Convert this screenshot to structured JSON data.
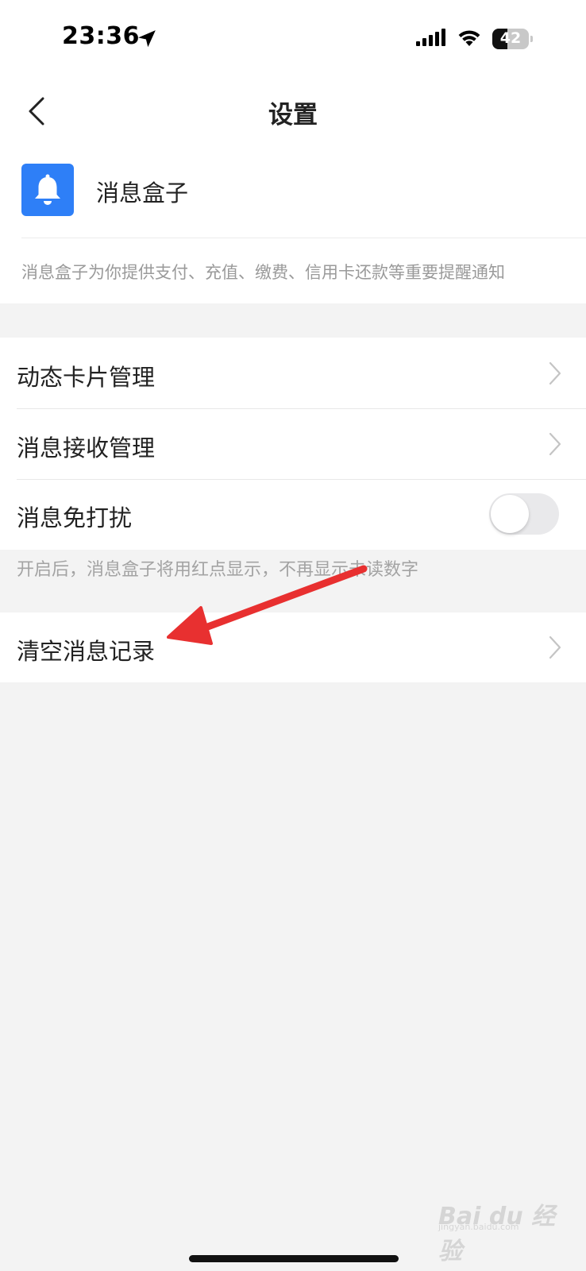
{
  "status_bar": {
    "time": "23:36",
    "battery": "42",
    "battery_level": 0.42,
    "icons": [
      "location-arrow-icon",
      "cellular-signal-icon",
      "wifi-icon",
      "battery-icon"
    ]
  },
  "nav": {
    "title": "设置",
    "back_icon": "chevron-left-icon"
  },
  "app": {
    "name": "消息盒子",
    "icon": "bell-icon",
    "icon_color": "#2e7ff7",
    "description": "消息盒子为你提供支付、充值、缴费、信用卡还款等重要提醒通知"
  },
  "settings": {
    "items": [
      {
        "label": "动态卡片管理",
        "control": "chevron"
      },
      {
        "label": "消息接收管理",
        "control": "chevron"
      },
      {
        "label": "消息免打扰",
        "control": "toggle",
        "on": false
      }
    ],
    "dnd_hint": "开启后，消息盒子将用红点显示，不再显示未读数字",
    "clear": {
      "label": "清空消息记录",
      "control": "chevron"
    }
  },
  "annotation": {
    "arrow_color": "#e83030",
    "points_to": "清空消息记录"
  },
  "watermark": {
    "brand": "Bai du 经验",
    "url": "jingyan.baidu.com"
  }
}
